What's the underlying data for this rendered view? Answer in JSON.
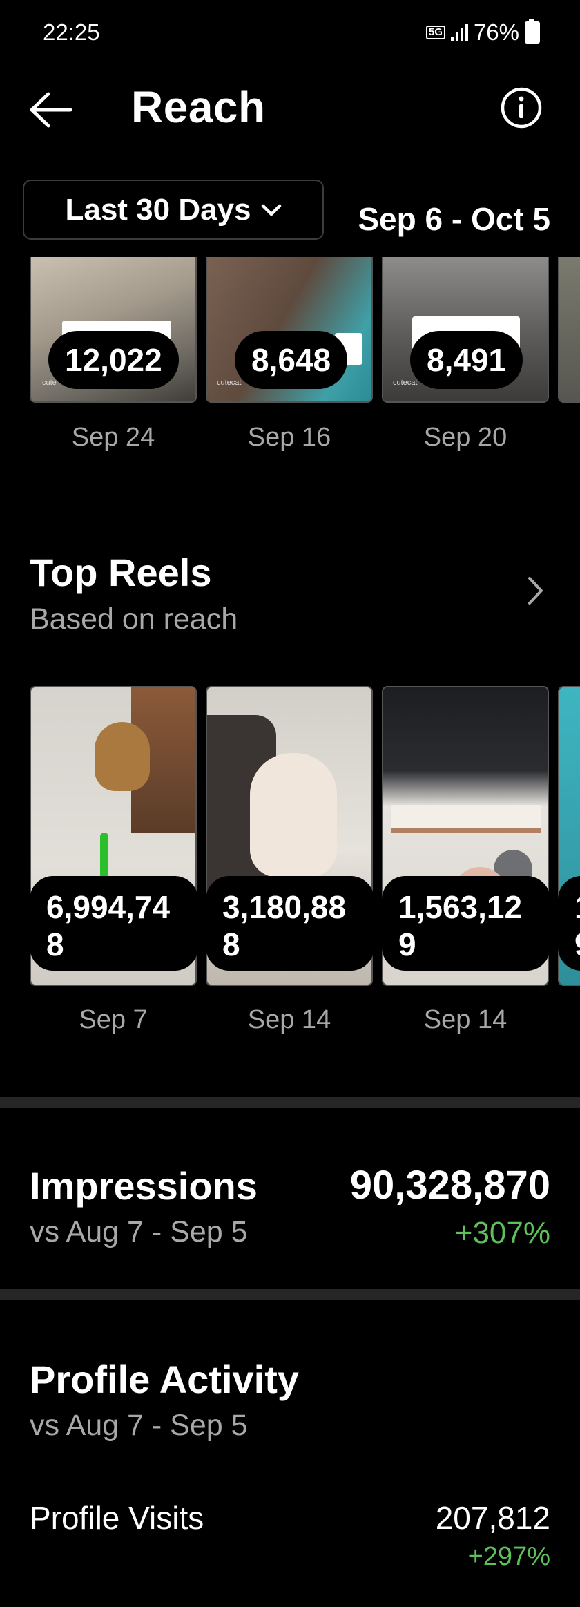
{
  "status_bar": {
    "time": "22:25",
    "network": "5G",
    "battery": "76%"
  },
  "header": {
    "title": "Reach",
    "back_icon": "arrow-left-icon",
    "info_icon": "info-icon"
  },
  "date_filter": {
    "selected": "Last 30 Days",
    "range": "Sep 6 - Oct 5"
  },
  "top_posts": [
    {
      "value": "12,022",
      "date": "Sep 24"
    },
    {
      "value": "8,648",
      "date": "Sep 16"
    },
    {
      "value": "8,491",
      "date": "Sep 20"
    }
  ],
  "top_reels": {
    "title": "Top Reels",
    "subtitle": "Based on reach",
    "items": [
      {
        "value": "6,994,74\n8",
        "date": "Sep 7"
      },
      {
        "value": "3,180,88\n8",
        "date": "Sep 14"
      },
      {
        "value": "1,563,12\n9",
        "date": "Sep 14"
      }
    ],
    "partial_value": "1\n9"
  },
  "impressions": {
    "title": "Impressions",
    "compare": "vs Aug 7 - Sep 5",
    "value": "90,328,870",
    "change": "+307%"
  },
  "profile_activity": {
    "title": "Profile Activity",
    "compare": "vs Aug 7 - Sep 5",
    "visits_label": "Profile Visits",
    "visits_value": "207,812",
    "visits_change": "+297%"
  },
  "colors": {
    "background": "#000000",
    "positive": "#5ec05a",
    "muted_text": "#a8a8a8"
  }
}
